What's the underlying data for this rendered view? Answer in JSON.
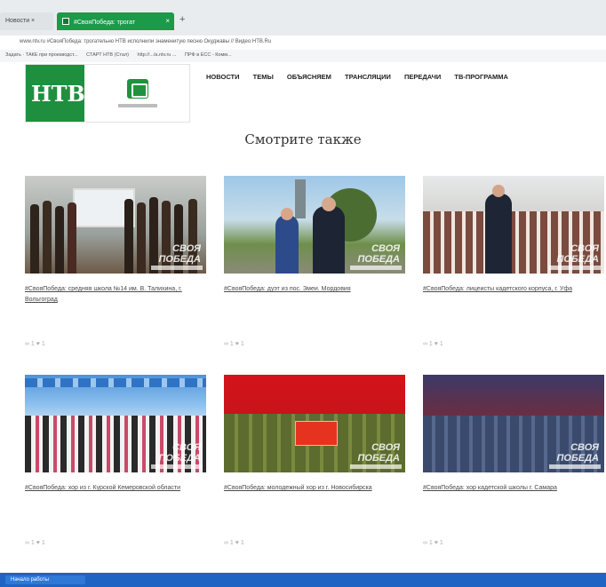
{
  "browser": {
    "tabs": [
      {
        "label": "Новости ×"
      },
      {
        "label": "#СвояПобеда: трогат",
        "close": "×"
      }
    ],
    "new_tab": "+",
    "address": "www.ntv.ru   #СвояПобеда: трогательно НТВ исполнили знаменитую песню Окуджавы // Видео НТВ.Ru",
    "bookmarks": [
      "Задать · ТАКЕ при производст...",
      "СТАРТ НТВ (Стал)",
      "http://.../a.ntv.ru ...",
      "ПРФ в ЕСС - Комм..."
    ]
  },
  "site": {
    "logo_text": "НТВ",
    "nav": [
      "НОВОСТИ",
      "ТЕМЫ",
      "ОБЪЯСНЯЕМ",
      "ТРАНСЛЯЦИИ",
      "ПЕРЕДАЧИ",
      "ТВ-ПРОГРАММА"
    ],
    "section_title": "Смотрите также"
  },
  "cards": [
    {
      "title": "#СвояПобеда: средняя школа №14 им. В. Талихина, г. Вольгоград",
      "meta": "∞ 1  ♥ 1"
    },
    {
      "title": "#СвояПобеда: дуэт из пос. Змеи. Мордовия",
      "meta": "∞ 1  ♥ 1"
    },
    {
      "title": "#СвояПобеда: лицеисты кадетского корпуса, г. Уфа",
      "meta": "∞ 1  ♥ 1"
    },
    {
      "title": "#СвояПобеда: хор из г. Курской Кемеровской области",
      "meta": "∞ 1  ♥ 1"
    },
    {
      "title": "#СвояПобеда: молодежный хор из г. Новосибирска",
      "meta": "∞ 1  ♥ 1"
    },
    {
      "title": "#СвояПобеда: хор кадетской школы г. Самара",
      "meta": "∞ 1  ♥ 1"
    }
  ],
  "watermark": "СВОЯ ПОБЕДА",
  "taskbar": {
    "start": "Начало работы"
  }
}
